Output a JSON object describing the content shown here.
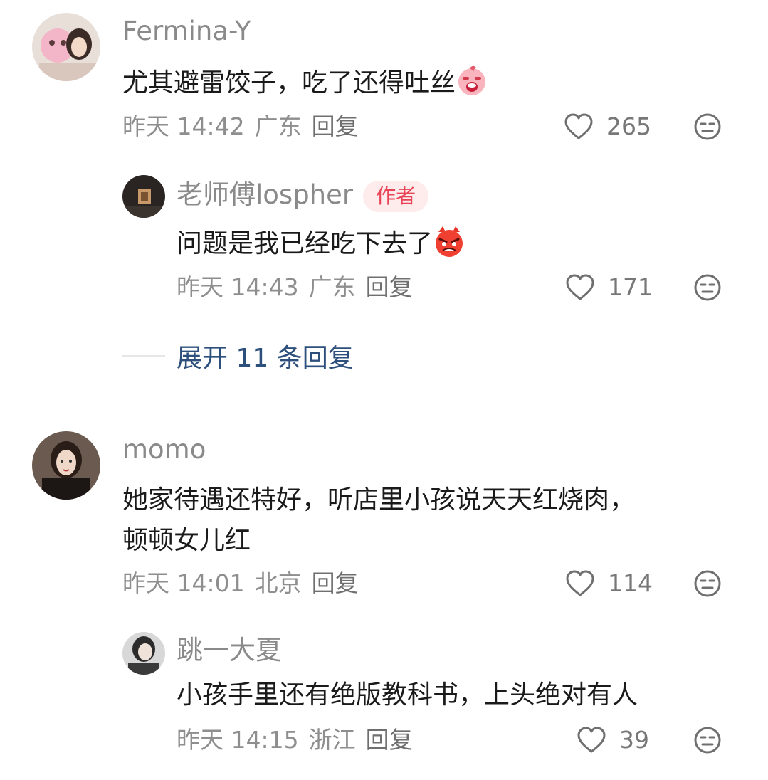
{
  "comments": [
    {
      "username": "Fermina-Y",
      "text": "尤其避雷饺子，吃了还得吐丝",
      "time": "昨天 14:42",
      "location": "广东",
      "reply_label": "回复",
      "likes": "265",
      "emoji": "crying-face-emoji"
    },
    {
      "username": "老师傅lospher",
      "badge": "作者",
      "text": "问题是我已经吃下去了",
      "time": "昨天 14:43",
      "location": "广东",
      "reply_label": "回复",
      "likes": "171",
      "emoji": "angry-face-emoji"
    },
    {
      "username": "momo",
      "text_line1": "她家待遇还特好，听店里小孩说天天红烧肉，",
      "text_line2": "顿顿女儿红",
      "time": "昨天 14:01",
      "location": "北京",
      "reply_label": "回复",
      "likes": "114"
    },
    {
      "username": "跳一大夏",
      "text": "小孩手里还有绝版教科书，上头绝对有人",
      "time": "昨天 14:15",
      "location": "浙江",
      "reply_label": "回复",
      "likes": "39"
    }
  ],
  "expand_replies": "展开 11 条回复",
  "colors": {
    "badge_bg": "#fdeceb",
    "badge_text": "#e84356",
    "expand_link": "#2d4f7c",
    "meta_gray": "#8e8e8e"
  },
  "icons": {
    "like": "heart-outline-icon",
    "dislike": "meh-face-icon"
  }
}
